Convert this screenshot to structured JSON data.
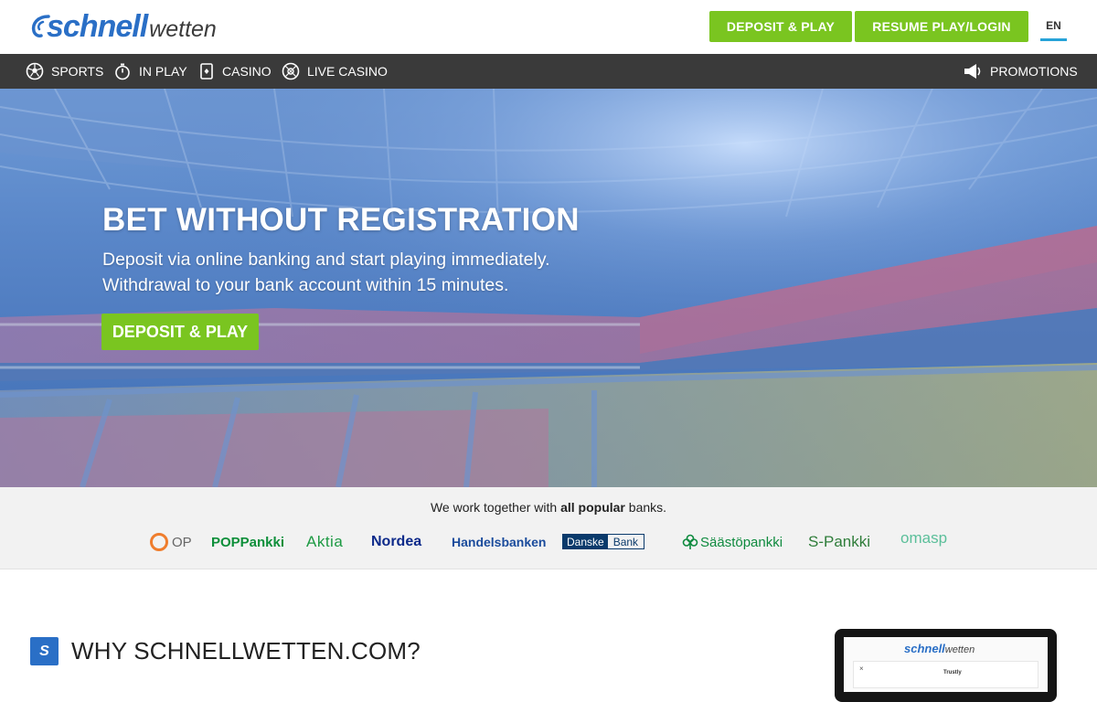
{
  "header": {
    "logo_main": "schnell",
    "logo_sub": "wetten",
    "deposit_button": "DEPOSIT & PLAY",
    "resume_button": "RESUME PLAY/LOGIN",
    "language": "EN"
  },
  "nav": {
    "items": [
      {
        "label": "SPORTS",
        "icon": "soccer-ball-icon"
      },
      {
        "label": "IN PLAY",
        "icon": "stopwatch-icon"
      },
      {
        "label": "CASINO",
        "icon": "cards-icon"
      },
      {
        "label": "LIVE CASINO",
        "icon": "roulette-icon"
      }
    ],
    "promotions": {
      "label": "PROMOTIONS",
      "icon": "megaphone-icon"
    }
  },
  "hero": {
    "title": "BET WITHOUT REGISTRATION",
    "line1": "Deposit via online banking and start playing immediately.",
    "line2": "Withdrawal to your bank account within 15 minutes.",
    "button": "DEPOSIT & PLAY"
  },
  "banks": {
    "intro_prefix": "We work together with ",
    "intro_bold": "all popular",
    "intro_suffix": " banks.",
    "logos": {
      "op": "OP",
      "pop": "POPPankki",
      "aktia": "Aktia",
      "nordea": "Nordea",
      "handelsbanken": "Handelsbanken",
      "danske_1": "Danske",
      "danske_2": "Bank",
      "saastopankki": "Säästöpankki",
      "spankki": "S-Pankki",
      "omasp": "omasp"
    }
  },
  "why": {
    "title": "WHY SCHNELLWETTEN.COM?",
    "icon_letter": "S"
  },
  "device": {
    "logo_main": "schnell",
    "logo_sub": "wetten",
    "close": "×",
    "trustly": "Trustly"
  },
  "colors": {
    "accent_green": "#7ac520",
    "brand_blue": "#2a6fc6",
    "nav_bg": "#3a3a3a",
    "lang_underline": "#27a3d8"
  }
}
